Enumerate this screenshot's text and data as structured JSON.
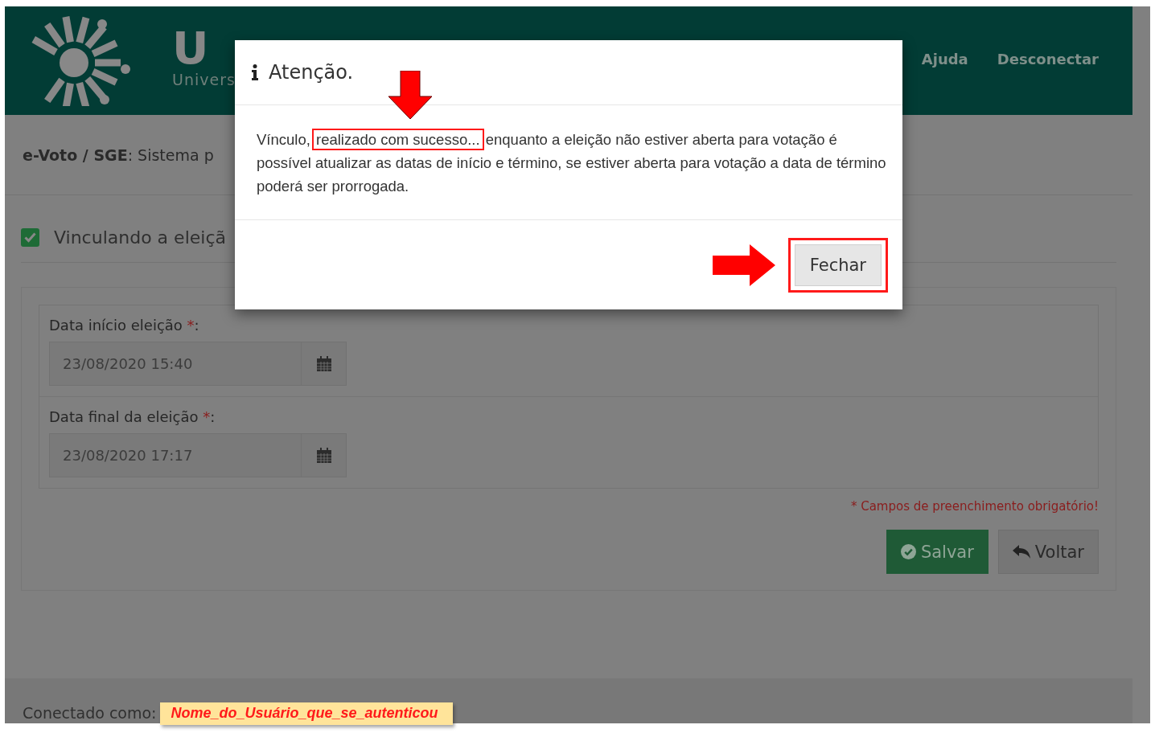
{
  "header": {
    "logo_title": "U",
    "logo_subtitle": "Univers",
    "nav": [
      {
        "label": "Ajuda"
      },
      {
        "label": "Desconectar"
      }
    ]
  },
  "breadcrumb": "**e-Voto / SGE**: Sistema p",
  "section": {
    "title": "Vinculando a eleiçã",
    "checked": true
  },
  "form": {
    "fields": [
      {
        "label": "Data início eleição",
        "required_mark": "*",
        "suffix": ":",
        "value": "23/08/2020 15:40"
      },
      {
        "label": "Data final da eleição",
        "required_mark": "*",
        "suffix": ":",
        "value": "23/08/2020 17:17"
      }
    ],
    "note": "* Campos de preenchimento obrigatório!",
    "buttons": [
      {
        "label": "Salvar",
        "kind": "primary"
      },
      {
        "label": "Voltar",
        "kind": "back"
      }
    ]
  },
  "footer": {
    "label": "Conectado como:",
    "user": "Nome_do_Usuário_que_se_autenticou"
  },
  "modal": {
    "title": "Atenção.",
    "message_start": "Vínculo,",
    "message_highlight": "realizado com sucesso...",
    "message_end": "enquanto a eleição não estiver aberta para votação é possível atualizar as datas de início e término, se estiver aberta para votação a data de término poderá ser prorrogada.",
    "button": "Fechar"
  }
}
